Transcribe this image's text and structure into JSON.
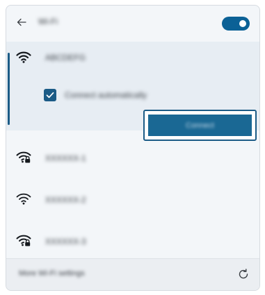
{
  "header": {
    "title": "Wi-Fi",
    "toggle_on": true,
    "accent_color": "#0b6196"
  },
  "networks": [
    {
      "name": "ABCDEFG",
      "secured": false,
      "expanded": true,
      "connect_automatically_label": "Connect automatically",
      "connect_automatically_checked": true,
      "connect_button_label": "Connect"
    },
    {
      "name": "XXXXXX-1",
      "secured": true
    },
    {
      "name": "XXXXXX-2",
      "secured": false
    },
    {
      "name": "XXXXXX-3",
      "secured": true
    }
  ],
  "footer": {
    "link_label": "More Wi-Fi settings",
    "refresh_icon": "refresh-icon"
  }
}
